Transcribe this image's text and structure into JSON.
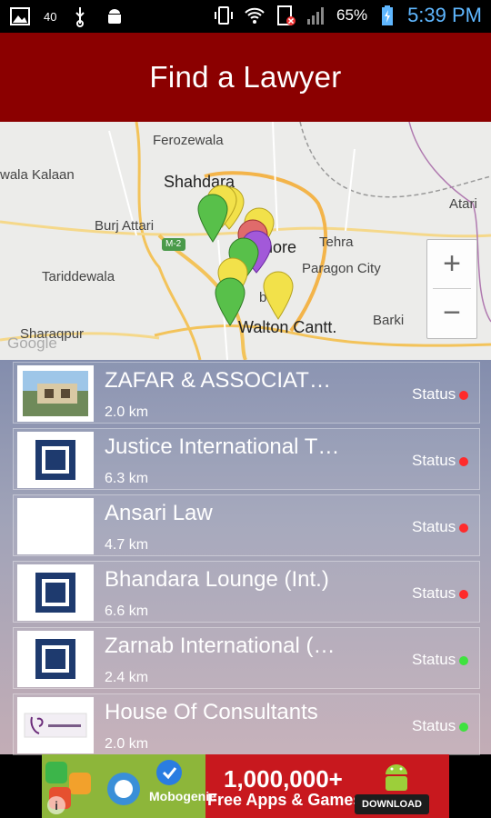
{
  "status_bar": {
    "network_speed": "40",
    "battery_percent": "65%",
    "time": "5:39 PM",
    "icons": [
      "image-icon",
      "usb-icon",
      "android-debug-icon",
      "vibrate-icon",
      "wifi-icon",
      "sim-blocked-icon",
      "signal-icon",
      "battery-charging-icon"
    ]
  },
  "app_bar": {
    "title": "Find a Lawyer"
  },
  "map": {
    "labels": {
      "ferozewala": "Ferozewala",
      "wala_kalaan": "wala Kalaan",
      "shahdara": "Shahdara",
      "burj_attari": "Burj Attari",
      "lahore": "Lahore",
      "tehra": "Tehra",
      "atari": "Atari",
      "tariddewala": "Tariddewala",
      "paragon_city": "Paragon City",
      "barki": "Barki",
      "sharaqpur": "Sharaqpur",
      "walton_cantt": "Walton Cantt.",
      "bergh": "berg",
      "motorway": "M-2",
      "google": "Google"
    },
    "zoom_in": "+",
    "zoom_out": "−",
    "marker_colors": {
      "green": "#58c04a",
      "yellow": "#f2e14a",
      "red": "#e06b6b",
      "purple": "#a259d9"
    }
  },
  "lawyers": [
    {
      "name": "ZAFAR & ASSOCIAT…",
      "distance": "2.0 km",
      "status_label": "Status",
      "status_color": "#ff2b2b",
      "thumb": "photo"
    },
    {
      "name": "Justice International T…",
      "distance": "6.3 km",
      "status_label": "Status",
      "status_color": "#ff2b2b",
      "thumb": "frame"
    },
    {
      "name": "Ansari Law",
      "distance": "4.7 km",
      "status_label": "Status",
      "status_color": "#ff2b2b",
      "thumb": "blank"
    },
    {
      "name": "Bhandara Lounge (Int.)",
      "distance": "6.6 km",
      "status_label": "Status",
      "status_color": "#ff2b2b",
      "thumb": "frame"
    },
    {
      "name": "Zarnab International (…",
      "distance": "2.4 km",
      "status_label": "Status",
      "status_color": "#3fe23f",
      "thumb": "frame"
    },
    {
      "name": "House Of Consultants",
      "distance": "2.0 km",
      "status_label": "Status",
      "status_color": "#3fe23f",
      "thumb": "logo"
    }
  ],
  "ad": {
    "brand": "Mobogenie",
    "count": "1,000,000+",
    "subtitle": "Free Apps & Games",
    "download": "DOWNLOAD",
    "info": "i"
  }
}
